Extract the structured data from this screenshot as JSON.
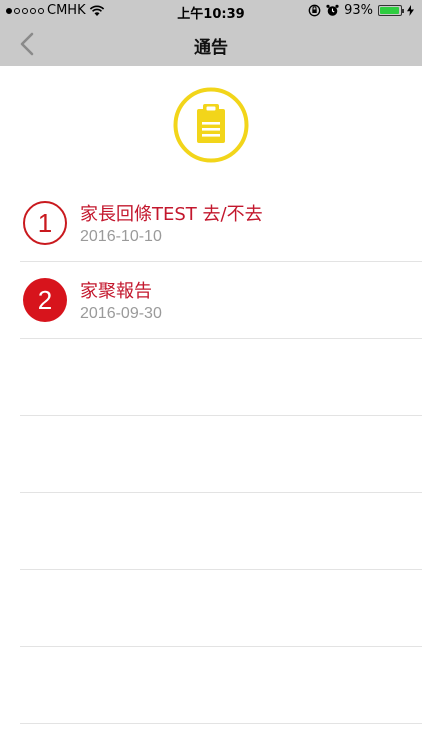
{
  "status_bar": {
    "carrier": "CMHK",
    "time": "上午10:39",
    "battery": "93%",
    "battery_level": 0.93,
    "signal_bars_filled": 1,
    "signal_bars_total": 5
  },
  "nav": {
    "title": "通告",
    "back_icon": "chevron-left-icon"
  },
  "header_icon": "clipboard-notice-icon",
  "colors": {
    "accent_red": "#c3172d",
    "icon_yellow": "#f2d51a",
    "nav_bg": "#c9c9c9"
  },
  "notices": [
    {
      "number": "1",
      "title": "家長回條TEST 去/不去",
      "date": "2016-10-10",
      "style": "outline"
    },
    {
      "number": "2",
      "title": "家聚報告",
      "date": "2016-09-30",
      "style": "solid"
    }
  ]
}
